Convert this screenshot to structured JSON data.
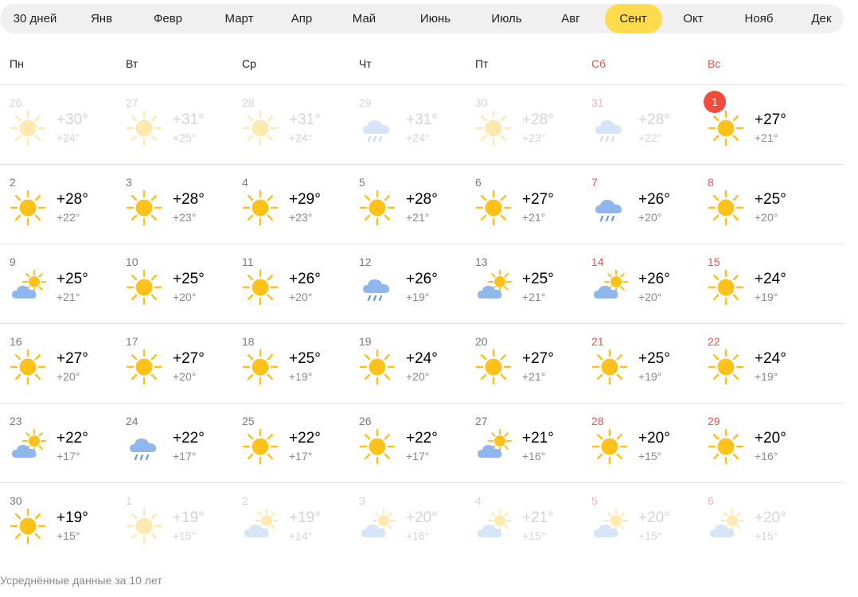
{
  "tabs": [
    "30 дней",
    "Янв",
    "Февр",
    "Март",
    "Апр",
    "Май",
    "Июнь",
    "Июль",
    "Авг",
    "Сент",
    "Окт",
    "Нояб",
    "Дек"
  ],
  "active_tab": 9,
  "weekdays": [
    {
      "label": "Пн",
      "weekend": false
    },
    {
      "label": "Вт",
      "weekend": false
    },
    {
      "label": "Ср",
      "weekend": false
    },
    {
      "label": "Чт",
      "weekend": false
    },
    {
      "label": "Пт",
      "weekend": false
    },
    {
      "label": "Сб",
      "weekend": true
    },
    {
      "label": "Вс",
      "weekend": true
    }
  ],
  "weeks": [
    [
      {
        "d": "26",
        "hi": "+30°",
        "lo": "+24°",
        "icon": "sun-icon",
        "faded": true
      },
      {
        "d": "27",
        "hi": "+31°",
        "lo": "+25°",
        "icon": "sun-icon",
        "faded": true
      },
      {
        "d": "28",
        "hi": "+31°",
        "lo": "+24°",
        "icon": "sun-icon",
        "faded": true
      },
      {
        "d": "29",
        "hi": "+31°",
        "lo": "+24°",
        "icon": "rain-cloud-icon",
        "faded": true
      },
      {
        "d": "30",
        "hi": "+28°",
        "lo": "+23°",
        "icon": "sun-icon",
        "faded": true
      },
      {
        "d": "31",
        "hi": "+28°",
        "lo": "+22°",
        "icon": "rain-cloud-icon",
        "faded": true
      },
      {
        "d": "1",
        "hi": "+27°",
        "lo": "+21°",
        "icon": "sun-icon",
        "today": true
      }
    ],
    [
      {
        "d": "2",
        "hi": "+28°",
        "lo": "+22°",
        "icon": "sun-icon"
      },
      {
        "d": "3",
        "hi": "+28°",
        "lo": "+23°",
        "icon": "sun-icon"
      },
      {
        "d": "4",
        "hi": "+29°",
        "lo": "+23°",
        "icon": "sun-icon"
      },
      {
        "d": "5",
        "hi": "+28°",
        "lo": "+21°",
        "icon": "sun-icon"
      },
      {
        "d": "6",
        "hi": "+27°",
        "lo": "+21°",
        "icon": "sun-icon"
      },
      {
        "d": "7",
        "hi": "+26°",
        "lo": "+20°",
        "icon": "rain-cloud-icon"
      },
      {
        "d": "8",
        "hi": "+25°",
        "lo": "+20°",
        "icon": "sun-icon"
      }
    ],
    [
      {
        "d": "9",
        "hi": "+25°",
        "lo": "+21°",
        "icon": "partly-cloudy-icon"
      },
      {
        "d": "10",
        "hi": "+25°",
        "lo": "+20°",
        "icon": "sun-icon"
      },
      {
        "d": "11",
        "hi": "+26°",
        "lo": "+20°",
        "icon": "sun-icon"
      },
      {
        "d": "12",
        "hi": "+26°",
        "lo": "+19°",
        "icon": "rain-cloud-icon"
      },
      {
        "d": "13",
        "hi": "+25°",
        "lo": "+21°",
        "icon": "partly-cloudy-icon"
      },
      {
        "d": "14",
        "hi": "+26°",
        "lo": "+20°",
        "icon": "partly-cloudy-icon"
      },
      {
        "d": "15",
        "hi": "+24°",
        "lo": "+19°",
        "icon": "sun-icon"
      }
    ],
    [
      {
        "d": "16",
        "hi": "+27°",
        "lo": "+20°",
        "icon": "sun-icon"
      },
      {
        "d": "17",
        "hi": "+27°",
        "lo": "+20°",
        "icon": "sun-icon"
      },
      {
        "d": "18",
        "hi": "+25°",
        "lo": "+19°",
        "icon": "sun-icon"
      },
      {
        "d": "19",
        "hi": "+24°",
        "lo": "+20°",
        "icon": "sun-icon"
      },
      {
        "d": "20",
        "hi": "+27°",
        "lo": "+21°",
        "icon": "sun-icon"
      },
      {
        "d": "21",
        "hi": "+25°",
        "lo": "+19°",
        "icon": "sun-icon"
      },
      {
        "d": "22",
        "hi": "+24°",
        "lo": "+19°",
        "icon": "sun-icon"
      }
    ],
    [
      {
        "d": "23",
        "hi": "+22°",
        "lo": "+17°",
        "icon": "partly-cloudy-icon"
      },
      {
        "d": "24",
        "hi": "+22°",
        "lo": "+17°",
        "icon": "rain-cloud-icon"
      },
      {
        "d": "25",
        "hi": "+22°",
        "lo": "+17°",
        "icon": "sun-icon"
      },
      {
        "d": "26",
        "hi": "+22°",
        "lo": "+17°",
        "icon": "sun-icon"
      },
      {
        "d": "27",
        "hi": "+21°",
        "lo": "+16°",
        "icon": "partly-cloudy-icon"
      },
      {
        "d": "28",
        "hi": "+20°",
        "lo": "+15°",
        "icon": "sun-icon"
      },
      {
        "d": "29",
        "hi": "+20°",
        "lo": "+16°",
        "icon": "sun-icon"
      }
    ],
    [
      {
        "d": "30",
        "hi": "+19°",
        "lo": "+15°",
        "icon": "sun-icon"
      },
      {
        "d": "1",
        "hi": "+19°",
        "lo": "+15°",
        "icon": "sun-icon",
        "faded": true
      },
      {
        "d": "2",
        "hi": "+19°",
        "lo": "+14°",
        "icon": "partly-cloudy-icon",
        "faded": true
      },
      {
        "d": "3",
        "hi": "+20°",
        "lo": "+16°",
        "icon": "partly-cloudy-icon",
        "faded": true
      },
      {
        "d": "4",
        "hi": "+21°",
        "lo": "+15°",
        "icon": "partly-cloudy-icon",
        "faded": true
      },
      {
        "d": "5",
        "hi": "+20°",
        "lo": "+15°",
        "icon": "partly-cloudy-icon",
        "faded": true
      },
      {
        "d": "6",
        "hi": "+20°",
        "lo": "+15°",
        "icon": "partly-cloudy-icon",
        "faded": true
      }
    ]
  ],
  "footnote": "Усреднённые данные за 10 лет",
  "colors": {
    "accent": "#ffdb4d",
    "today": "#f24c3d",
    "weekend": "#e8534a",
    "sun": "#ffc21a",
    "cloud": "#a9c8f0",
    "rain": "#5b9ae6"
  }
}
